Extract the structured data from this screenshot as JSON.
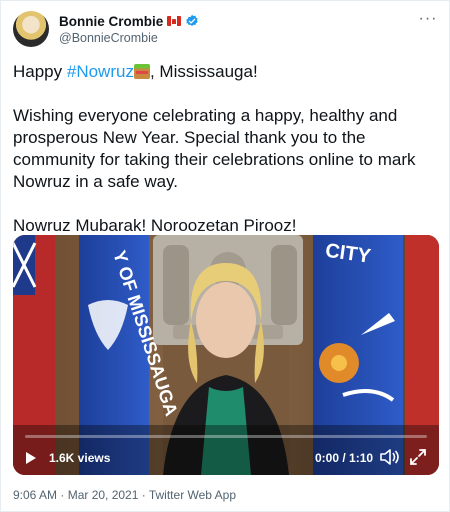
{
  "user": {
    "display_name": "Bonnie Crombie",
    "handle": "@BonnieCrombie",
    "flag_icon": "canada-flag-icon",
    "verified_icon": "verified-badge-icon",
    "verified_color": "#1d9bf0"
  },
  "tweet": {
    "line1_prefix": "Happy ",
    "hashtag": "#Nowruz",
    "line1_suffix": ", Mississauga!",
    "paragraph_lines": [
      "Wishing everyone celebrating a happy, healthy and",
      "prosperous New Year. Special thank you to the",
      "community for taking their celebrations online to mark",
      "Nowruz in a safe way."
    ],
    "closing": "Nowruz Mubarak! Noroozetan Pirooz!"
  },
  "video": {
    "views": "1.6K views",
    "time": "0:00 / 1:10",
    "progress": 0,
    "banner_text_left": "Y OF MISSISSAUGA",
    "banner_text_right": "CITY"
  },
  "meta": {
    "timestamp": "9:06 AM · Mar 20, 2021 · Twitter Web App"
  },
  "colors": {
    "link": "#1d9bf0",
    "secondary_text": "#536471"
  }
}
